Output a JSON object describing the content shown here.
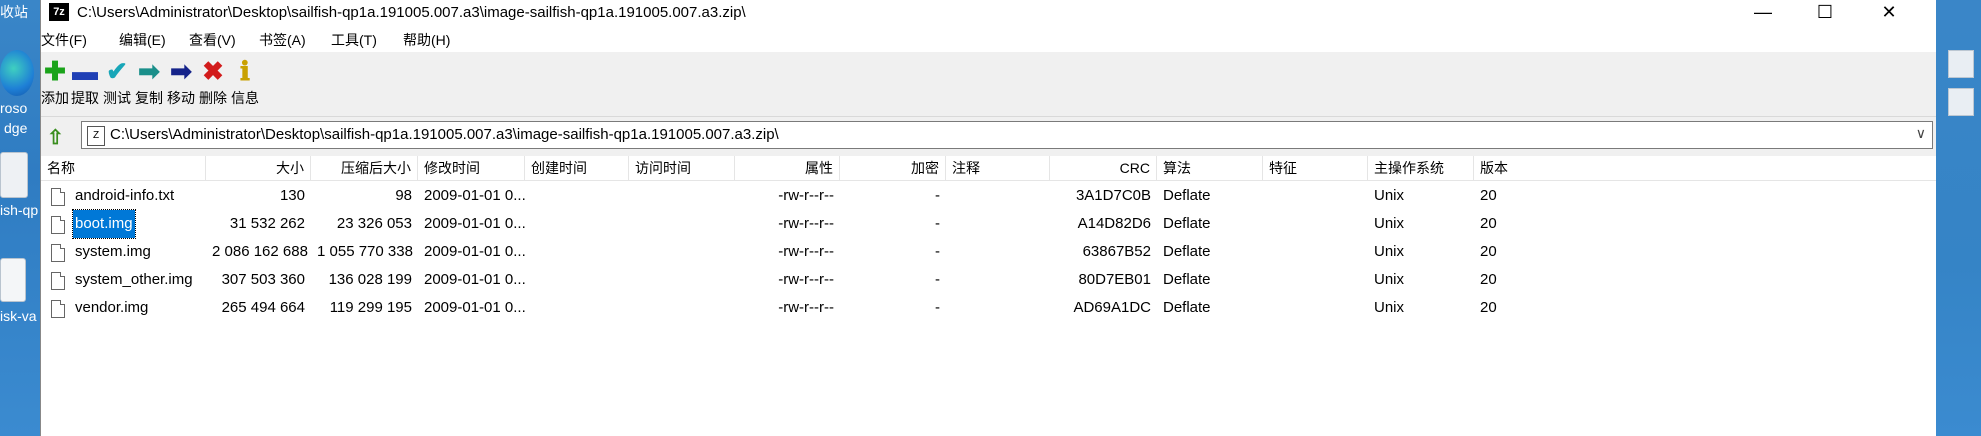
{
  "desktop": {
    "labels": [
      "收站",
      "roso",
      "dge",
      "ish-qp",
      "isk-va"
    ]
  },
  "window": {
    "title": "C:\\Users\\Administrator\\Desktop\\sailfish-qp1a.191005.007.a3\\image-sailfish-qp1a.191005.007.a3.zip\\",
    "app_icon_text": "7z",
    "minimize": "—",
    "maximize": "☐",
    "close": "✕"
  },
  "menu": [
    "文件(F)",
    "编辑(E)",
    "查看(V)",
    "书签(A)",
    "工具(T)",
    "帮助(H)"
  ],
  "toolbar": [
    {
      "label": "添加",
      "icon": "plus-icon",
      "glyph": "✚",
      "color": "#1aa31a"
    },
    {
      "label": "提取",
      "icon": "minus-icon",
      "glyph": "▬",
      "color": "#1f3fb5"
    },
    {
      "label": "测试",
      "icon": "check-icon",
      "glyph": "✔",
      "color": "#18a6b8"
    },
    {
      "label": "复制",
      "icon": "copy-arrow-icon",
      "glyph": "➡",
      "color": "#1a8f8a"
    },
    {
      "label": "移动",
      "icon": "move-arrow-icon",
      "glyph": "➡",
      "color": "#15238a"
    },
    {
      "label": "删除",
      "icon": "delete-icon",
      "glyph": "✖",
      "color": "#d21b1b"
    },
    {
      "label": "信息",
      "icon": "info-icon",
      "glyph": "ℹ",
      "color": "#c9a100"
    }
  ],
  "address": {
    "path": "C:\\Users\\Administrator\\Desktop\\sailfish-qp1a.191005.007.a3\\image-sailfish-qp1a.191005.007.a3.zip\\",
    "dropdown": "∨"
  },
  "columns": [
    "名称",
    "大小",
    "压缩后大小",
    "修改时间",
    "创建时间",
    "访问时间",
    "属性",
    "加密",
    "注释",
    "CRC",
    "算法",
    "特征",
    "主操作系统",
    "版本"
  ],
  "files": [
    {
      "name": "android-info.txt",
      "size": "130",
      "packed": "98",
      "modified": "2009-01-01 0...",
      "attr": "-rw-r--r--",
      "enc": "-",
      "crc": "3A1D7C0B",
      "method": "Deflate",
      "os": "Unix",
      "ver": "20"
    },
    {
      "name": "boot.img",
      "size": "31 532 262",
      "packed": "23 326 053",
      "modified": "2009-01-01 0...",
      "attr": "-rw-r--r--",
      "enc": "-",
      "crc": "A14D82D6",
      "method": "Deflate",
      "os": "Unix",
      "ver": "20",
      "selected": true
    },
    {
      "name": "system.img",
      "size": "2 086 162 688",
      "packed": "1 055 770 338",
      "modified": "2009-01-01 0...",
      "attr": "-rw-r--r--",
      "enc": "-",
      "crc": "63867B52",
      "method": "Deflate",
      "os": "Unix",
      "ver": "20"
    },
    {
      "name": "system_other.img",
      "size": "307 503 360",
      "packed": "136 028 199",
      "modified": "2009-01-01 0...",
      "attr": "-rw-r--r--",
      "enc": "-",
      "crc": "80D7EB01",
      "method": "Deflate",
      "os": "Unix",
      "ver": "20"
    },
    {
      "name": "vendor.img",
      "size": "265 494 664",
      "packed": "119 299 195",
      "modified": "2009-01-01 0...",
      "attr": "-rw-r--r--",
      "enc": "-",
      "crc": "AD69A1DC",
      "method": "Deflate",
      "os": "Unix",
      "ver": "20"
    }
  ]
}
